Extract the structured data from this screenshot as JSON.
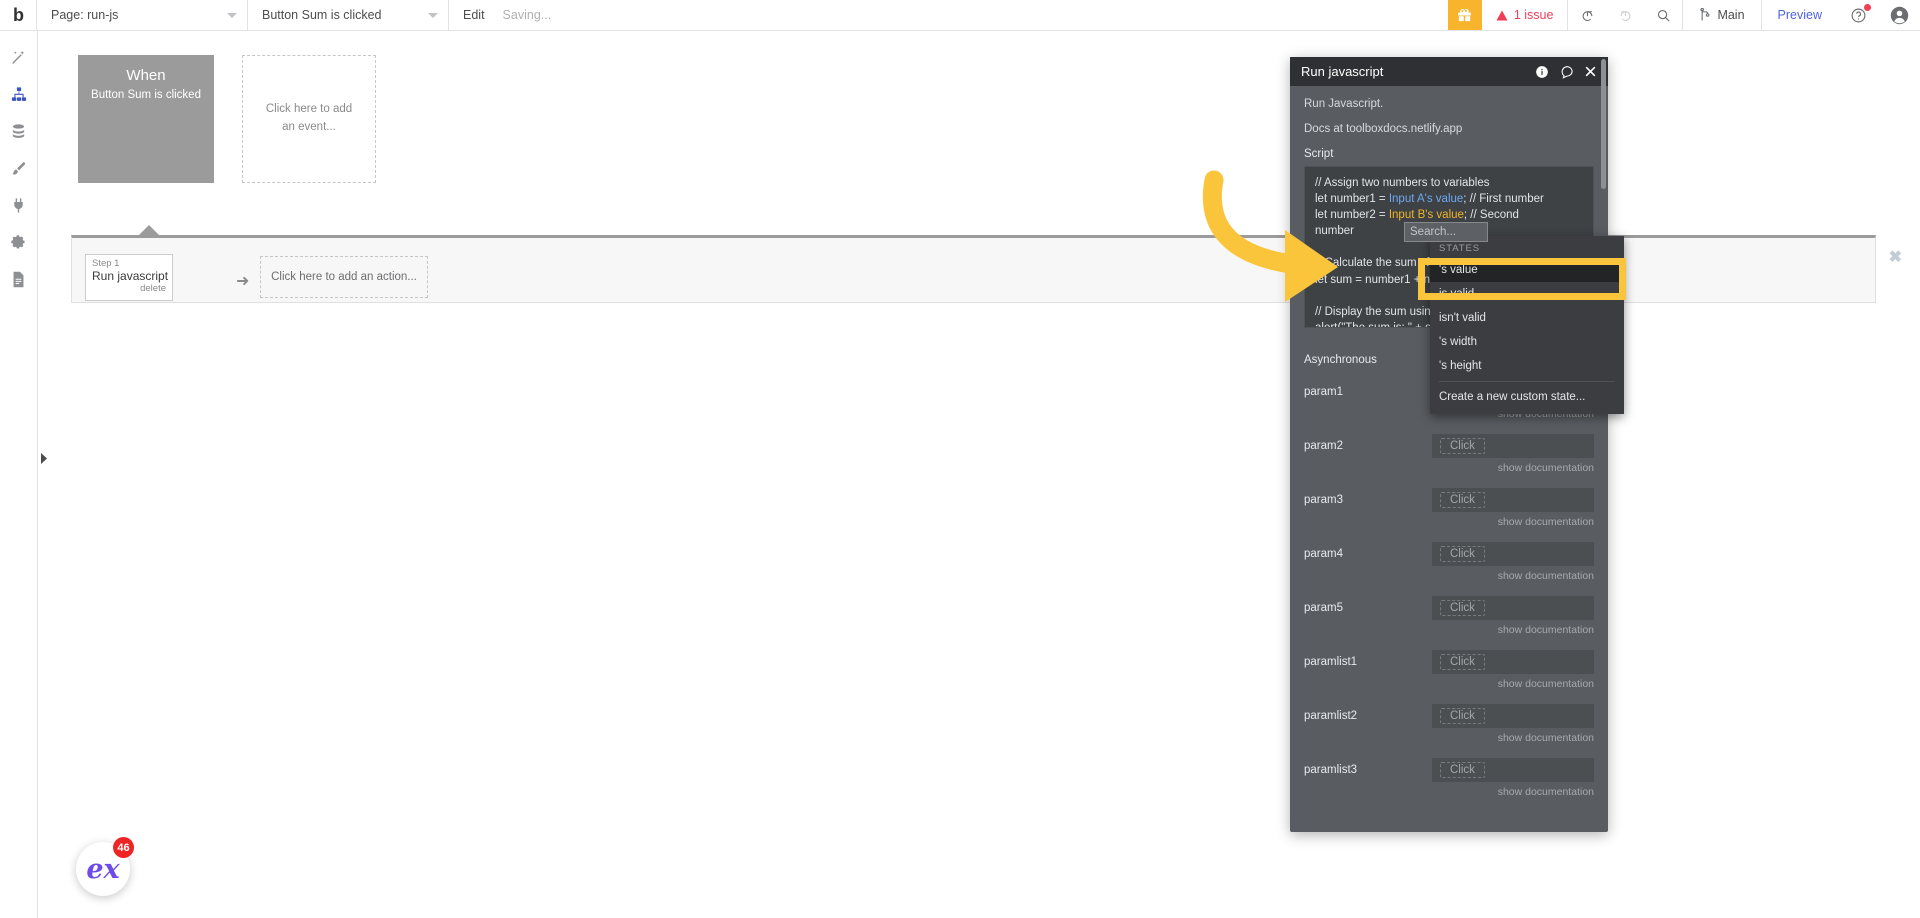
{
  "topbar": {
    "logo": "b",
    "page_select": {
      "label": "Page: run-js",
      "icon": "chevron-down-icon"
    },
    "event_select": {
      "label": "Button Sum is clicked",
      "icon": "chevron-down-icon"
    },
    "edit_label": "Edit",
    "saving_label": "Saving...",
    "gift_icon": "gift-icon",
    "issue_label": "1 issue",
    "issue_color": "#ef3e56",
    "undo_icon": "undo-icon",
    "redo_icon": "redo-icon",
    "search_icon": "search-icon",
    "branch_label": "Main",
    "branch_icon": "branch-icon",
    "preview_label": "Preview",
    "preview_color": "#4e63e0",
    "help_icon": "help-circle-icon",
    "avatar_icon": "user-avatar-icon"
  },
  "sidebar": {
    "items": [
      {
        "name": "design",
        "icon": "wand-icon",
        "active": false
      },
      {
        "name": "workflow",
        "icon": "workflow-icon",
        "active": true
      },
      {
        "name": "data",
        "icon": "database-icon",
        "active": false
      },
      {
        "name": "styles",
        "icon": "paintbrush-icon",
        "active": false
      },
      {
        "name": "plugins",
        "icon": "plug-icon",
        "active": false
      },
      {
        "name": "settings",
        "icon": "gear-icon",
        "active": false
      },
      {
        "name": "logs",
        "icon": "document-icon",
        "active": false
      }
    ],
    "expander_icon": "chevron-right-icon"
  },
  "canvas": {
    "when_block": {
      "title": "When",
      "subtitle": "Button Sum is clicked"
    },
    "add_event_placeholder": "Click here to add an event...",
    "step": {
      "number_label": "Step 1",
      "name": "Run javascript",
      "delete_label": "delete"
    },
    "flow_arrow_icon": "arrow-right-icon",
    "add_action_placeholder": "Click here to add an action...",
    "close_icon": "close-icon"
  },
  "ex_widget": {
    "logo_text": "ex",
    "badge_count": "46",
    "badge_color": "#ef2424"
  },
  "panel": {
    "title": "Run javascript",
    "header_icons": [
      "info-icon",
      "comment-icon",
      "close-icon"
    ],
    "description_line1": "Run Javascript.",
    "description_line2": "Docs at toolboxdocs.netlify.app",
    "script_label": "Script",
    "script_lines": [
      {
        "segments": [
          {
            "t": "// Assign two numbers to variables",
            "c": "cmt"
          }
        ]
      },
      {
        "segments": [
          {
            "t": "let number1 = ",
            "c": "cmt"
          },
          {
            "t": "Input A's value",
            "c": "dyn"
          },
          {
            "t": "; // First number",
            "c": "cmt"
          }
        ]
      },
      {
        "segments": [
          {
            "t": "let number2 = ",
            "c": "cmt"
          },
          {
            "t": "Input B's value",
            "c": "dyn-o"
          },
          {
            "t": "; // Second",
            "c": "cmt"
          }
        ]
      },
      {
        "segments": [
          {
            "t": "number",
            "c": "cmt"
          }
        ]
      },
      {
        "segments": [
          {
            "t": "",
            "c": "cmt"
          }
        ]
      },
      {
        "segments": [
          {
            "t": "// Calculate the sum of the two numbers",
            "c": "cmt"
          }
        ]
      },
      {
        "segments": [
          {
            "t": "let sum = number1 + number2;",
            "c": "cmt"
          }
        ]
      },
      {
        "segments": [
          {
            "t": "",
            "c": "cmt"
          }
        ]
      },
      {
        "segments": [
          {
            "t": "// Display the sum using an alert",
            "c": "cmt"
          }
        ]
      },
      {
        "segments": [
          {
            "t": "alert(\"The sum is: \" + sum);",
            "c": "cmt"
          }
        ]
      }
    ],
    "search_placeholder": "Search...",
    "dropdown": {
      "section_label": "STATES",
      "items": [
        {
          "label": "'s value",
          "selected": true
        },
        {
          "label": "is valid",
          "selected": false
        },
        {
          "label": "isn't valid",
          "selected": false
        },
        {
          "label": "'s width",
          "selected": false
        },
        {
          "label": "'s height",
          "selected": false
        }
      ],
      "create_label": "Create a new custom state..."
    },
    "show_documentation_label": "show documentation",
    "click_placeholder": "Click",
    "fields": [
      {
        "name": "Asynchronous",
        "type": "checkbox"
      },
      {
        "name": "param1",
        "type": "click"
      },
      {
        "name": "param2",
        "type": "click"
      },
      {
        "name": "param3",
        "type": "click"
      },
      {
        "name": "param4",
        "type": "click"
      },
      {
        "name": "param5",
        "type": "click"
      },
      {
        "name": "paramlist1",
        "type": "click"
      },
      {
        "name": "paramlist2",
        "type": "click"
      },
      {
        "name": "paramlist3",
        "type": "click"
      }
    ]
  },
  "annotation": {
    "arrow_color": "#fac53b",
    "highlight_color": "#fac53b"
  }
}
